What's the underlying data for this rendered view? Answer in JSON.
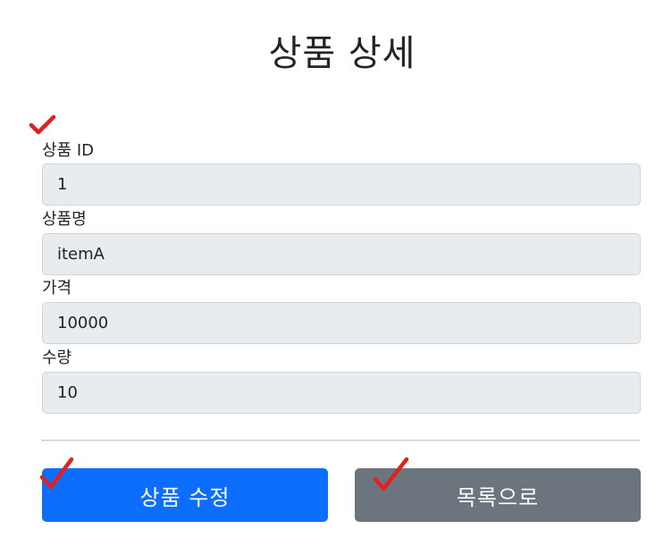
{
  "page": {
    "title": "상품 상세"
  },
  "form": {
    "fields": [
      {
        "label": "상품 ID",
        "value": "1"
      },
      {
        "label": "상품명",
        "value": "itemA"
      },
      {
        "label": "가격",
        "value": "10000"
      },
      {
        "label": "수량",
        "value": "10"
      }
    ]
  },
  "actions": {
    "edit_label": "상품 수정",
    "list_label": "목록으로"
  },
  "colors": {
    "primary": "#0d6efd",
    "secondary": "#6c757d",
    "field_bg": "#e9ecef",
    "annotation": "#e0211d"
  },
  "annotations": {
    "icon": "red-checkmark-icon"
  }
}
